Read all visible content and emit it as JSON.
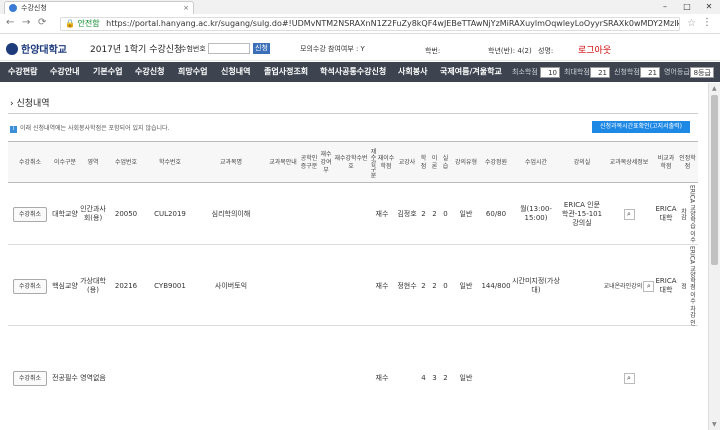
{
  "browser": {
    "tab_title": "수강신청",
    "secure_label": "안전함",
    "url": "https://portal.hanyang.ac.kr/sugang/sulg.do#!UDMvNTM2NSRAXnN1Z2FuZy8kQF4wJEBeTTAwNjYzMiRAXuylmOqwleyLoOyyrSRAXk0wMDY2MzIkQF5mNjcwYWU1"
  },
  "header": {
    "logo": "한양대학교",
    "semester": "2017년 1학기 수강신청",
    "student_no_label": "수험번호",
    "student_btn": "신청",
    "consent_label": "모의수강 참여여부 : Y",
    "dept_label": "학번:",
    "grade_label": "학년(반): 4(2)",
    "name_label": "성명:",
    "logout": "로그아웃"
  },
  "nav": {
    "items": [
      "수강편람",
      "수강안내",
      "기본수업",
      "수강신청",
      "희망수업",
      "신청내역",
      "졸업사정조회",
      "학석사공통수강신청",
      "사회봉사",
      "국제여름/겨울학교"
    ],
    "credits": [
      {
        "label": "최소학점",
        "value": "10"
      },
      {
        "label": "최대학점",
        "value": "21"
      },
      {
        "label": "신청학점",
        "value": "21"
      },
      {
        "label": "영어등급",
        "value": "8등급"
      }
    ]
  },
  "page": {
    "title": "신청내역",
    "notice": "이래 신청내역에는 사회봉사학점은 포함되어 있지 않습니다.",
    "timetable_btn": "신청과목시간표확인(고지서출력)"
  },
  "table": {
    "headers": [
      "수강취소",
      "이수구분",
      "영역",
      "수업번호",
      "학수번호",
      "교과목명",
      "교과목안내",
      "공학인증구분",
      "재수강여부",
      "재수강학수번호",
      "재수강구분",
      "재이수학점",
      "교강사",
      "학점",
      "이론",
      "실습",
      "강의유형",
      "수강정원",
      "수업시간",
      "강의실",
      "교과목상세정보",
      "비교과학점",
      "인정학점"
    ],
    "rows": [
      {
        "cancel": "수강취소",
        "category": "대학교양",
        "area": "인간과사회(용)",
        "class_no": "20050",
        "course_no": "CUL2019",
        "course_name": "심리학의이해",
        "retake": "재수",
        "instructor": "김정호",
        "credit": "2",
        "theory": "2",
        "practice": "0",
        "type": "일반",
        "capacity": "60/80",
        "time": "월(13:00-15:00)",
        "room": "ERICA 인문 학관-15-101 강의실",
        "detail": "",
        "extra": "ERICA대학",
        "approved": "ERICA 교양학습 이수 차감"
      },
      {
        "cancel": "수강취소",
        "category": "핵심교양",
        "area": "가상대학(용)",
        "class_no": "20216",
        "course_no": "CYB9001",
        "course_name": "사이버토익",
        "retake": "재수",
        "instructor": "정현수",
        "credit": "2",
        "theory": "2",
        "practice": "0",
        "type": "일반",
        "capacity": "144/800",
        "time": "시간미지정(가상대)",
        "room": "",
        "detail": "교내온라인강의",
        "extra": "ERICA대학",
        "approved": "ERICA 교양학점 이수 차감 인정"
      },
      {
        "cancel": "수강취소",
        "category": "전공필수",
        "area": "영역없음",
        "class_no": "",
        "course_no": "",
        "course_name": "",
        "retake": "재수",
        "instructor": "",
        "credit": "4",
        "theory": "3",
        "practice": "2",
        "type": "일반",
        "capacity": "",
        "time": "",
        "room": "",
        "detail": "",
        "extra": "",
        "approved": ""
      }
    ]
  }
}
